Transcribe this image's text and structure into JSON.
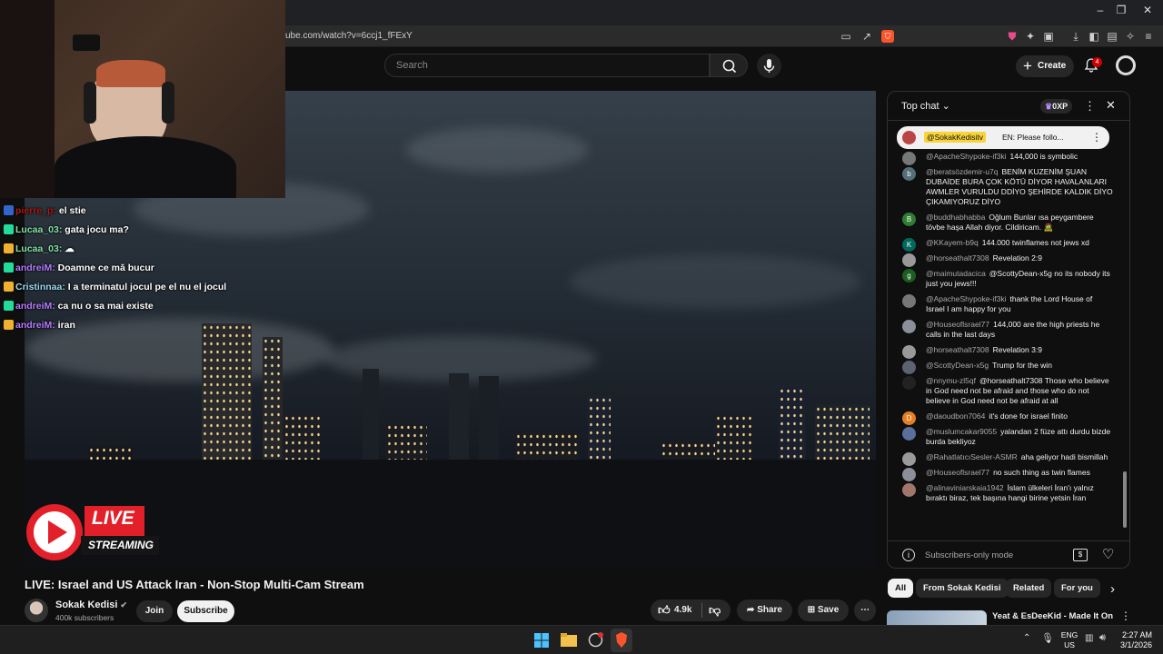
{
  "browser": {
    "url": "ube.com/watch?v=6ccj1_fFExY",
    "window_controls": [
      "–",
      "❐",
      "✕"
    ]
  },
  "header": {
    "search_placeholder": "Search",
    "create_label": "Create",
    "notification_count": "4"
  },
  "webcam": {
    "label": "streamer webcam"
  },
  "overlay_chat": [
    {
      "user": "pierre_p:",
      "message": "el stie",
      "color": "#b01818"
    },
    {
      "user": "Lucaa_03:",
      "message": "gata jocu ma?",
      "color": "#86e0a8"
    },
    {
      "user": "Lucaa_03:",
      "message": "☁",
      "color": "#86e0a8"
    },
    {
      "user": "andreiM:",
      "message": "Doamne ce mă bucur",
      "color": "#b77bff"
    },
    {
      "user": "Cristinnaa:",
      "message": "I a terminatul jocul pe el nu el jocul",
      "color": "#9fd8f0"
    },
    {
      "user": "andreiM:",
      "message": "ca nu o sa mai existe",
      "color": "#b77bff"
    },
    {
      "user": "andreiM:",
      "message": "iran",
      "color": "#b77bff"
    }
  ],
  "video": {
    "live_badge": "LIVE",
    "streaming_badge": "STREAMING"
  },
  "title": "LIVE: Israel and US Attack Iran - Non-Stop Multi-Cam Stream",
  "channel": {
    "name": "Sokak Kedisi",
    "subscribers": "400k subscribers",
    "join_label": "Join",
    "subscribe_label": "Subscribe"
  },
  "actions": {
    "likes": "4.9k",
    "share_label": "Share",
    "save_label": "Save"
  },
  "chat": {
    "header": "Top chat",
    "oxp": "0XP",
    "pinned_user": "@SokakKedisitv",
    "pinned_message": "EN: Please follo...",
    "messages": [
      {
        "user": "@ApacheShypoke-if3ki",
        "text": "144,000 is symbolic",
        "avatar": "",
        "avcolor": "#777"
      },
      {
        "user": "@beratsözdemir-u7q",
        "text": "BENİM KUZENİM ŞUAN DUBAİDE BURA ÇOK KÖTÜ DİYOR HAVALANLARI AWMLER VURULDU DDİYO ŞEHİRDE KALDIK DİYO ÇIKAMIYORUZ DİYO",
        "avatar": "b",
        "avcolor": "#546e7a"
      },
      {
        "user": "@buddhabhabba",
        "text": "Oğlum Bunlar ısa peygambere tövbe haşa Allah diyor. Cildiricam. 🧟",
        "avatar": "B",
        "avcolor": "#2e7d32"
      },
      {
        "user": "@KKayem-b9q",
        "text": "144.000 twinflames not jews xd",
        "avatar": "K",
        "avcolor": "#00695c"
      },
      {
        "user": "@horseathalt7308",
        "text": "Revelation 2:9",
        "avatar": "",
        "avcolor": "#999"
      },
      {
        "user": "@maimutadacica",
        "text": "@ScottyDean-x5g no its nobody its just you jews!!!",
        "avatar": "g",
        "avcolor": "#1b5e20"
      },
      {
        "user": "@ApacheShypoke-if3ki",
        "text": "thank the Lord House of Israel I am happy for you",
        "avatar": "",
        "avcolor": "#777"
      },
      {
        "user": "@Houseoflsrael77",
        "text": "144,000 are the high priests he calls in the last days",
        "avatar": "",
        "avcolor": "#8a8f99"
      },
      {
        "user": "@horseathalt7308",
        "text": "Revelation 3:9",
        "avatar": "",
        "avcolor": "#999"
      },
      {
        "user": "@ScottyDean-x5g",
        "text": "Trump for the win",
        "avatar": "",
        "avcolor": "#5b6270"
      },
      {
        "user": "@nnymu-zl5qf",
        "text": "@horseathalt7308 Those who believe in God need not be afraid and those who do not believe in God need not be afraid at all",
        "avatar": "",
        "avcolor": "#222"
      },
      {
        "user": "@daoudbon7064",
        "text": "it's done for israel finito",
        "avatar": "D",
        "avcolor": "#e67e22"
      },
      {
        "user": "@muslumcakar9055",
        "text": "yalandan 2 füze attı durdu bizde burda bekliyoz",
        "avatar": "",
        "avcolor": "#5a6f9a"
      },
      {
        "user": "@RahatlatıcıSesler-ASMR",
        "text": "aha geliyor hadi bismillah",
        "avatar": "",
        "avcolor": "#9a9a9a"
      },
      {
        "user": "@Houseoflsrael77",
        "text": "no such thing as twin flames",
        "avatar": "",
        "avcolor": "#8a8f99"
      },
      {
        "user": "@alinaviniarskaia1942",
        "text": "İslam ülkeleri İran'ı yalnız bıraktı biraz, tek başına hangi birine yetsin İran",
        "avatar": "",
        "avcolor": "#a0766a"
      }
    ],
    "footer": "Subscribers-only mode"
  },
  "chips": [
    "All",
    "From Sokak Kedisi",
    "Related",
    "For you"
  ],
  "related": {
    "title": "Yeat & EsDeeKid - Made It On"
  },
  "taskbar": {
    "lang1": "ENG",
    "lang2": "US",
    "time": "2:27 AM",
    "date": "3/1/2026"
  }
}
